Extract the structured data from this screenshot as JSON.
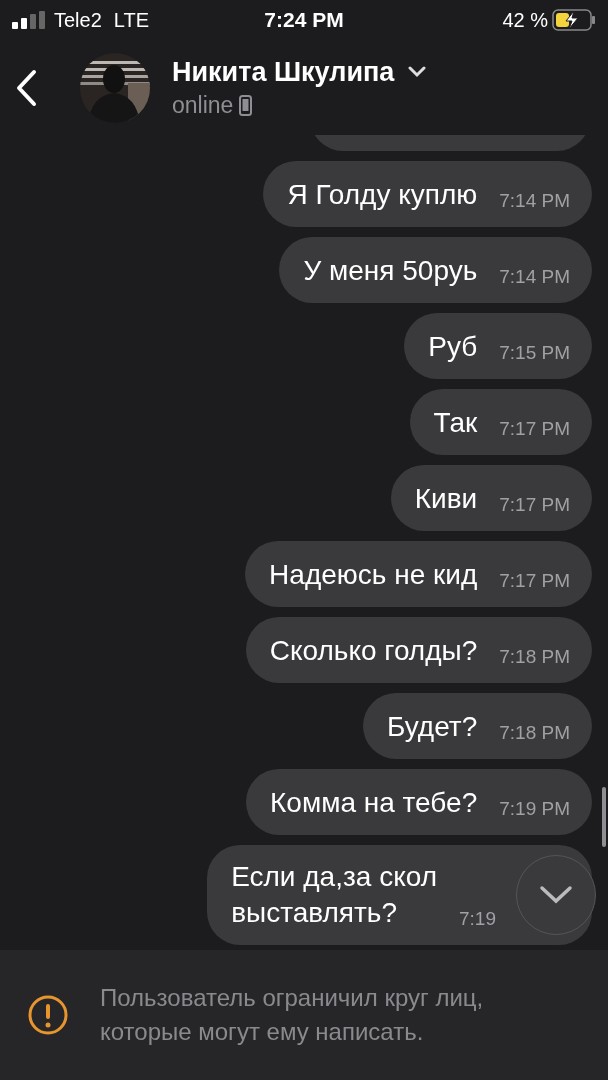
{
  "status_bar": {
    "carrier": "Tele2",
    "network": "LTE",
    "time": "7:24 PM",
    "battery_percent": "42 %",
    "charging": true
  },
  "header": {
    "name": "Никита Шкулипа",
    "status": "online"
  },
  "messages": [
    {
      "text": "Я Голду куплю",
      "time": "7:14 PM"
    },
    {
      "text": "У меня 50руь",
      "time": "7:14 PM"
    },
    {
      "text": "Руб",
      "time": "7:15 PM"
    },
    {
      "text": "Так",
      "time": "7:17 PM"
    },
    {
      "text": "Киви",
      "time": "7:17 PM"
    },
    {
      "text": "Надеюсь не кид",
      "time": "7:17 PM"
    },
    {
      "text": "Сколько голды?",
      "time": "7:18 PM"
    },
    {
      "text": "Будет?",
      "time": "7:18 PM"
    },
    {
      "text": "Комма на тебе?",
      "time": "7:19 PM"
    }
  ],
  "last_message": {
    "lines": [
      "Если да,за скол",
      "выставлять?"
    ],
    "time": "7:19"
  },
  "notice": {
    "text": "Пользователь ограничил круг лиц, которые могут ему написать."
  }
}
